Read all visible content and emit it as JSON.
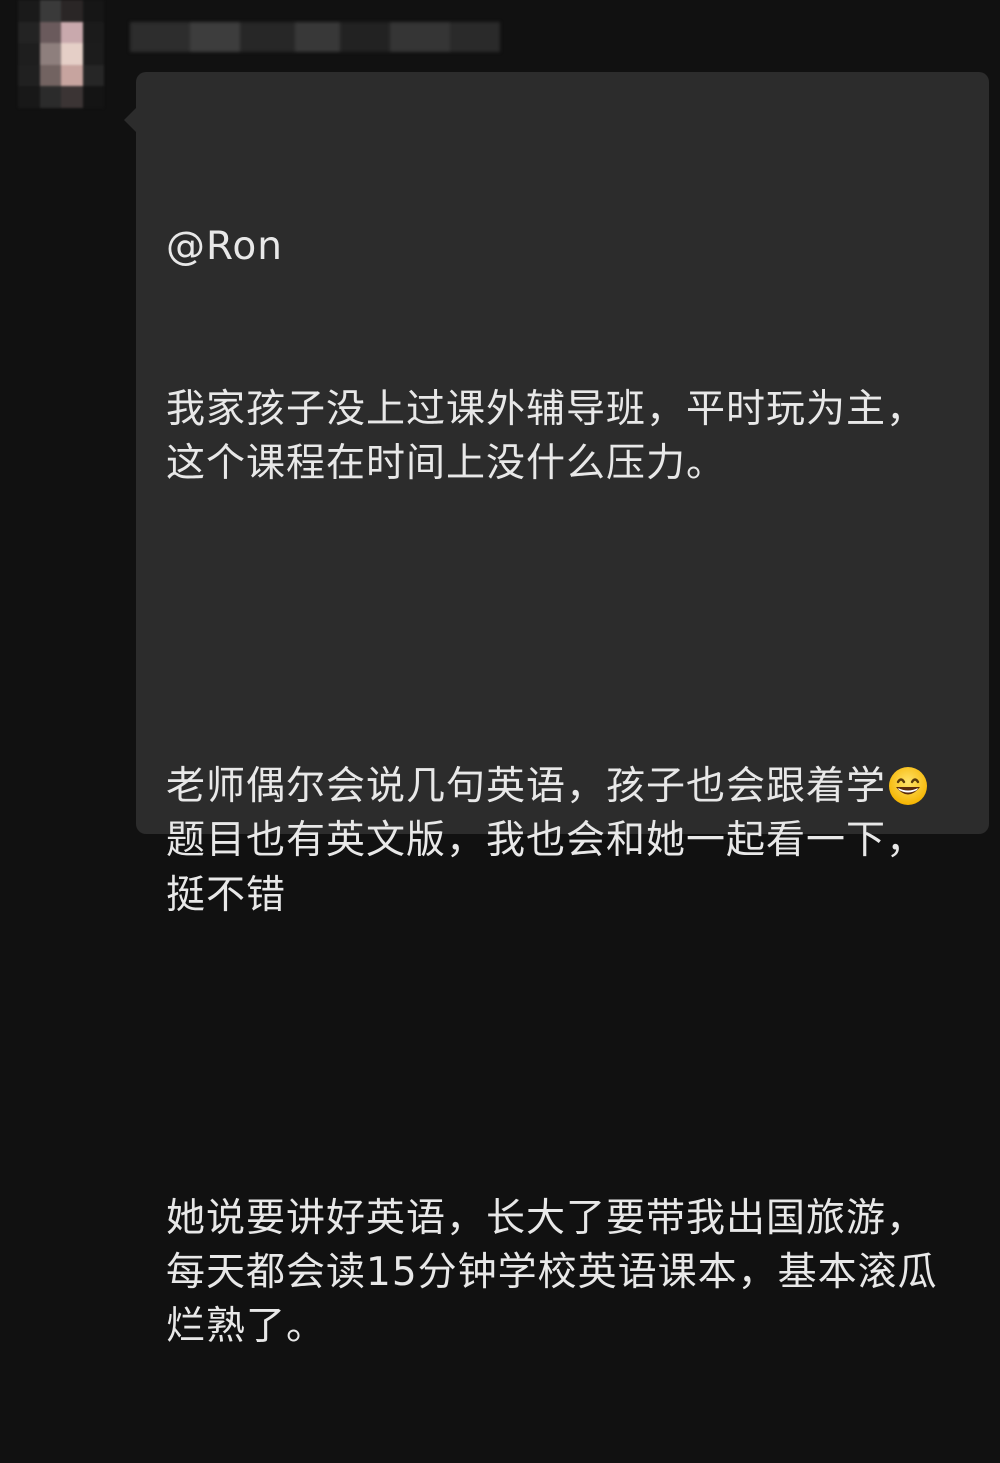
{
  "chat": {
    "message": {
      "mention": "@Ron",
      "paragraph_1": "我家孩子没上过课外辅导班，平时玩为主，这个课程在时间上没什么压力。",
      "paragraph_2_part_1": "老师偶尔会说几句英语，孩子也会跟着学",
      "paragraph_2_emoji": "grinning-face-emoji",
      "paragraph_2_part_2": "题目也有英文版，我也会和她一起看一下，挺不错",
      "paragraph_3": "她说要讲好英语，长大了要带我出国旅游，每天都会读15分钟学校英语课本，基本滚瓜烂熟了。"
    }
  },
  "colors": {
    "background": "#111111",
    "bubble": "#2c2c2c",
    "text": "#e8e8e8"
  }
}
